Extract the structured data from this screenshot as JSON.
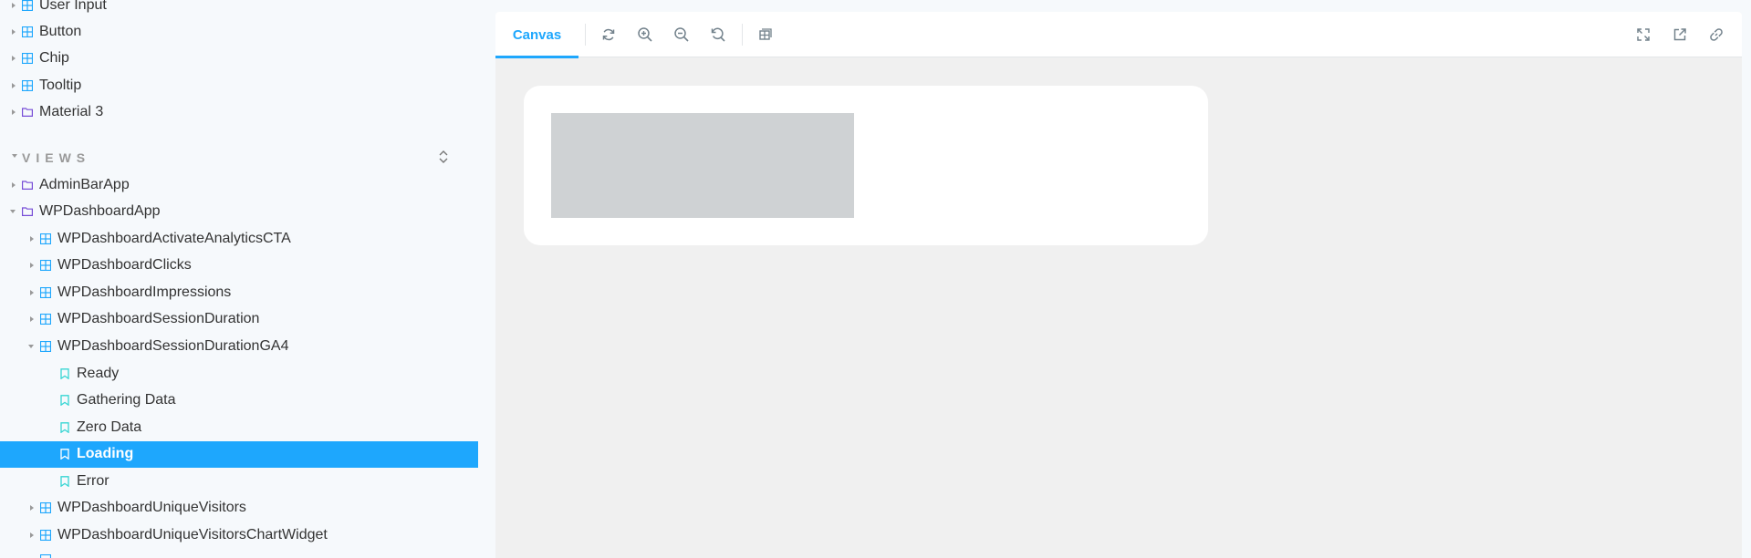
{
  "sidebar": {
    "items_top": [
      {
        "label": "User Input",
        "icon": "component-icon"
      },
      {
        "label": "Button",
        "icon": "component-icon"
      },
      {
        "label": "Chip",
        "icon": "component-icon"
      },
      {
        "label": "Tooltip",
        "icon": "component-icon"
      },
      {
        "label": "Material 3",
        "icon": "folder-icon"
      }
    ],
    "section_views": "VIEWS",
    "views_items": [
      {
        "label": "AdminBarApp",
        "icon": "folder-icon"
      },
      {
        "label": "WPDashboardApp",
        "icon": "folder-icon"
      },
      {
        "label": "WPDashboardActivateAnalyticsCTA",
        "icon": "component-icon"
      },
      {
        "label": "WPDashboardClicks",
        "icon": "component-icon"
      },
      {
        "label": "WPDashboardImpressions",
        "icon": "component-icon"
      },
      {
        "label": "WPDashboardSessionDuration",
        "icon": "component-icon"
      },
      {
        "label": "WPDashboardSessionDurationGA4",
        "icon": "component-icon"
      },
      {
        "label": "Ready",
        "icon": "bookmark-icon"
      },
      {
        "label": "Gathering Data",
        "icon": "bookmark-icon"
      },
      {
        "label": "Zero Data",
        "icon": "bookmark-icon"
      },
      {
        "label": "Loading",
        "icon": "bookmark-icon",
        "selected": true
      },
      {
        "label": "Error",
        "icon": "bookmark-icon"
      },
      {
        "label": "WPDashboardUniqueVisitors",
        "icon": "component-icon"
      },
      {
        "label": "WPDashboardUniqueVisitorsChartWidget",
        "icon": "component-icon"
      }
    ]
  },
  "toolbar": {
    "tab_canvas": "Canvas",
    "buttons": [
      "reload-icon",
      "zoom-in-icon",
      "zoom-out-icon",
      "zoom-reset-icon",
      "grid-icon",
      "fullscreen-icon",
      "open-new-tab-icon",
      "link-icon"
    ]
  },
  "colors": {
    "accent": "#1ea7fd",
    "sidebar_bg": "#f6f9fc",
    "canvas_bg": "#f0f0f0",
    "skeleton": "#cfd2d4",
    "component_icon": "#1ea7fd",
    "folder_icon": "#774dd7",
    "story_icon": "#37d5d3"
  }
}
